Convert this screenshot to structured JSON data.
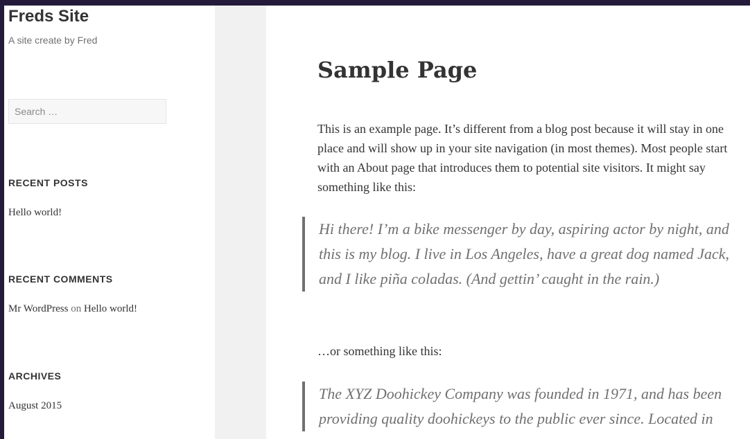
{
  "site": {
    "title": "Freds Site",
    "description": "A site create by Fred"
  },
  "search": {
    "placeholder": "Search …"
  },
  "widgets": {
    "recent_posts": {
      "title": "RECENT POSTS",
      "items": [
        "Hello world!"
      ]
    },
    "recent_comments": {
      "title": "RECENT COMMENTS",
      "author": "Mr WordPress",
      "connector": "on",
      "post": "Hello world!"
    },
    "archives": {
      "title": "ARCHIVES",
      "items": [
        "August 2015"
      ]
    }
  },
  "page": {
    "title": "Sample Page",
    "intro": "This is an example page. It’s different from a blog post because it will stay in one place and will show up in your site navigation (in most themes). Most people start with an About page that introduces them to potential site visitors. It might say something like this:",
    "quote1": "Hi there! I’m a bike messenger by day, aspiring actor by night, and this is my blog. I live in Los Angeles, have a great dog named Jack, and I like piña coladas. (And gettin’ caught in the rain.)",
    "middle": "…or something like this:",
    "quote2": "The XYZ Doohickey Company was founded in 1971, and has been providing quality doohickeys to the public ever since. Located in"
  }
}
